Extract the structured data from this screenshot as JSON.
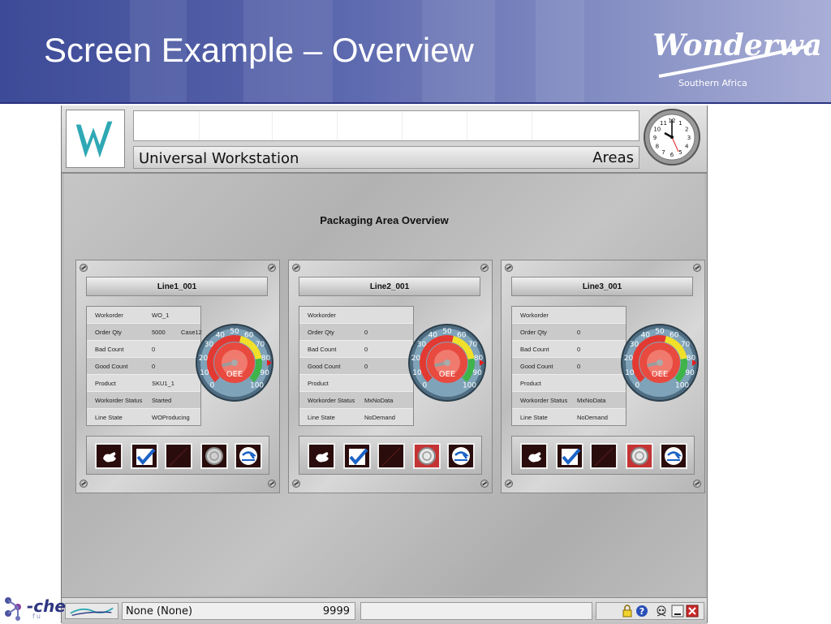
{
  "slide": {
    "title": "Screen Example – Overview",
    "brand_logo_text": "Wonderware",
    "brand_subtitle": "Southern Africa"
  },
  "corner_brand": {
    "text": "-che",
    "sub": "fu"
  },
  "app": {
    "title": "Universal Workstation",
    "areas_label": "Areas",
    "clock": {
      "numbers": [
        "12",
        "1",
        "2",
        "3",
        "4",
        "5",
        "6",
        "7",
        "8",
        "9",
        "10",
        "11"
      ]
    },
    "status_bar": {
      "user": "None (None)",
      "number": "9999",
      "message": ""
    }
  },
  "overview": {
    "title": "Packaging Area Overview",
    "row_labels": [
      "Workorder",
      "Order Qty",
      "Bad Count",
      "Good Count",
      "Product",
      "Workorder Status",
      "Line State"
    ],
    "gauge_ticks": [
      "0",
      "10",
      "20",
      "30",
      "40",
      "50",
      "60",
      "70",
      "80",
      "90",
      "100"
    ],
    "gauge_label": "OEE",
    "buttons": [
      "hand-icon",
      "check-icon",
      "blank-icon",
      "stop-icon",
      "reset-icon"
    ],
    "lines": [
      {
        "name": "Line1_001",
        "values": [
          "WO_1",
          "5000",
          "0",
          "0",
          "SKU1_1",
          "Started",
          "WOProducing"
        ],
        "order_qty_unit": "Case12",
        "stop_active": false
      },
      {
        "name": "Line2_001",
        "values": [
          "",
          "0",
          "0",
          "0",
          "",
          "MxNoData",
          "NoDemand"
        ],
        "order_qty_unit": "",
        "stop_active": true
      },
      {
        "name": "Line3_001",
        "values": [
          "",
          "0",
          "0",
          "0",
          "",
          "MxNoData",
          "NoDemand"
        ],
        "order_qty_unit": "",
        "stop_active": true
      }
    ]
  },
  "colors": {
    "header_blue": "#3d4a97",
    "gauge_red": "#e23a32",
    "gauge_yellow": "#f0e02a",
    "gauge_green": "#3fb44a",
    "button_dark": "#2a0c0c",
    "button_red": "#c43434",
    "check_blue": "#1b63c6"
  }
}
